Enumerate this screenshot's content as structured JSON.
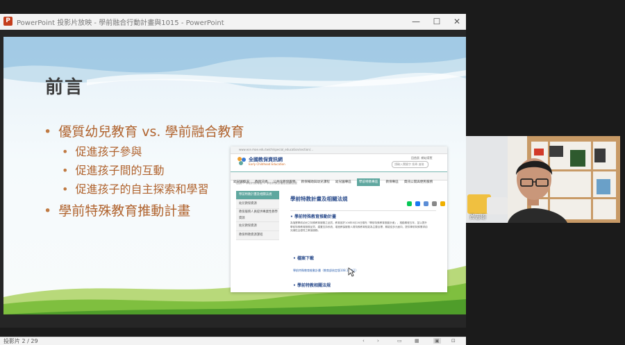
{
  "window": {
    "app_icon_letter": "P",
    "title": "PowerPoint 投影片放映  -  學前融合行動計畫與1015  -  PowerPoint",
    "minimize": "—",
    "maximize": "☐",
    "close": "✕"
  },
  "slide": {
    "title": "前言",
    "bullets": [
      {
        "text": "優質幼兒教育 vs. 學前融合教育",
        "sub": [
          "促進孩子參與",
          "促進孩子間的互動",
          "促進孩子的自主探索和學習"
        ]
      },
      {
        "text": "學前特殊教育推動計畫"
      }
    ]
  },
  "web": {
    "url": "www.ece.moe.edu.tw/ch/special_education/section/...",
    "site_name": "全國教保資訊網",
    "site_subtitle": "Early Childhood Education",
    "top_links": [
      "回首頁",
      "網站導覽"
    ],
    "search_placeholder": "請輸入關鍵字  搜尋  進階",
    "nav": [
      "幼兒園概況",
      "教保法規",
      "公共化教保服務",
      "教保輔助與幼兒課程",
      "幼兒園專區",
      "學前特教專區",
      "教保專區",
      "資訊公開與便民服務"
    ],
    "breadcrumb": "首頁 > 學前特教專區 > 學前特教計畫及相關法規",
    "sidebar": [
      "學前特教計畫及相關法規",
      "幼兒教保資源",
      "教保服務人員提供專業性教學資源",
      "幼兒教保資源",
      "教保特教資源課程"
    ],
    "page_title": "學前特教計畫及相關法規",
    "section1": "學前特殊教育推動計畫",
    "body_text": "為落實學前幼兒之特殊教育服務之品質，教育部於108年8月28日頒布「學前特殊教育推動計畫」，推動期程五年，並以提升學前特殊教育服務品質、建置支持系統、增進教保服務人員特殊教育知能為主要目標，期能從多元面向，提供學前特殊需求幼兒適性且優質之教保服務。",
    "section2": "檔案下載",
    "download_link": "學前特殊教育推動計畫（教育部核定版108.11修正）",
    "section3": "學前特教相關法規"
  },
  "statusbar": {
    "slide_counter": "投影片 2 / 29",
    "icons": [
      "‹",
      "›",
      "▭",
      "▦",
      "▣",
      "⊡"
    ]
  },
  "webcam": {
    "participant_name": "黃志雄"
  },
  "colors": {
    "accent_teal": "#5fa79f",
    "bullet_text": "#b0632e",
    "ppt_red": "#c43e1c"
  }
}
